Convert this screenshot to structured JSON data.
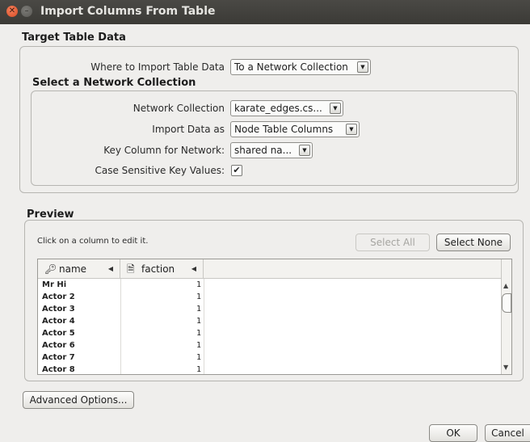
{
  "window": {
    "title": "Import Columns From Table"
  },
  "target_group": {
    "title": "Target Table Data",
    "where_label": "Where to Import Table Data",
    "where_value": "To a Network Collection"
  },
  "network_group": {
    "title": "Select a Network Collection",
    "collection_label": "Network Collection",
    "collection_value": "karate_edges.cs...",
    "import_as_label": "Import Data as",
    "import_as_value": "Node Table Columns",
    "key_label": "Key Column for Network:",
    "key_value": "shared na...",
    "case_label": "Case Sensitive Key Values:",
    "case_checked": true
  },
  "preview": {
    "title": "Preview",
    "hint": "Click on a column to edit it.",
    "select_all": "Select All",
    "select_none": "Select None",
    "columns": [
      {
        "name": "name",
        "icon": "key-icon"
      },
      {
        "name": "faction",
        "icon": "document-icon"
      }
    ],
    "rows": [
      {
        "name": "Mr Hi",
        "faction": "1"
      },
      {
        "name": "Actor 2",
        "faction": "1"
      },
      {
        "name": "Actor 3",
        "faction": "1"
      },
      {
        "name": "Actor 4",
        "faction": "1"
      },
      {
        "name": "Actor 5",
        "faction": "1"
      },
      {
        "name": "Actor 6",
        "faction": "1"
      },
      {
        "name": "Actor 7",
        "faction": "1"
      },
      {
        "name": "Actor 8",
        "faction": "1"
      }
    ]
  },
  "footer": {
    "advanced": "Advanced Options...",
    "ok": "OK",
    "cancel": "Cancel"
  }
}
